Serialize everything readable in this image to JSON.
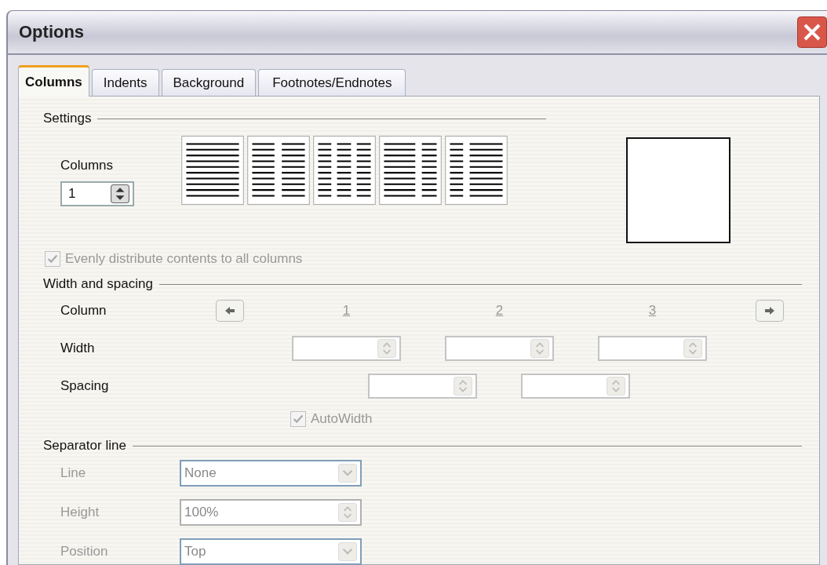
{
  "window": {
    "title": "Options"
  },
  "tabs": [
    {
      "label": "Columns",
      "selected": true
    },
    {
      "label": "Indents",
      "selected": false
    },
    {
      "label": "Background",
      "selected": false
    },
    {
      "label": "Footnotes/Endnotes",
      "selected": false
    }
  ],
  "settings": {
    "heading": "Settings",
    "columns_label": "Columns",
    "columns_value": "1",
    "presets": [
      {
        "kind": "one"
      },
      {
        "kind": "two"
      },
      {
        "kind": "three"
      },
      {
        "kind": "left-wide"
      },
      {
        "kind": "right-wide"
      }
    ],
    "even_distribute": {
      "label": "Evenly distribute contents to all columns",
      "checked": true,
      "disabled": true
    }
  },
  "width_spacing": {
    "heading": "Width and spacing",
    "column_label": "Column",
    "width_label": "Width",
    "spacing_label": "Spacing",
    "columns": [
      "1",
      "2",
      "3"
    ],
    "width_fields": [
      {
        "disabled": true
      },
      {
        "disabled": true
      },
      {
        "disabled": true
      }
    ],
    "spacing_fields": [
      {
        "disabled": true
      },
      {
        "disabled": true
      }
    ],
    "autowidth": {
      "label": "AutoWidth",
      "checked": true,
      "disabled": true
    }
  },
  "separator": {
    "heading": "Separator line",
    "rows": [
      {
        "label": "Line",
        "kind": "dropdown",
        "value": "None",
        "disabled": true
      },
      {
        "label": "Height",
        "kind": "spin",
        "value": "100%",
        "disabled": true
      },
      {
        "label": "Position",
        "kind": "dropdown",
        "value": "Top",
        "disabled": true
      }
    ]
  }
}
